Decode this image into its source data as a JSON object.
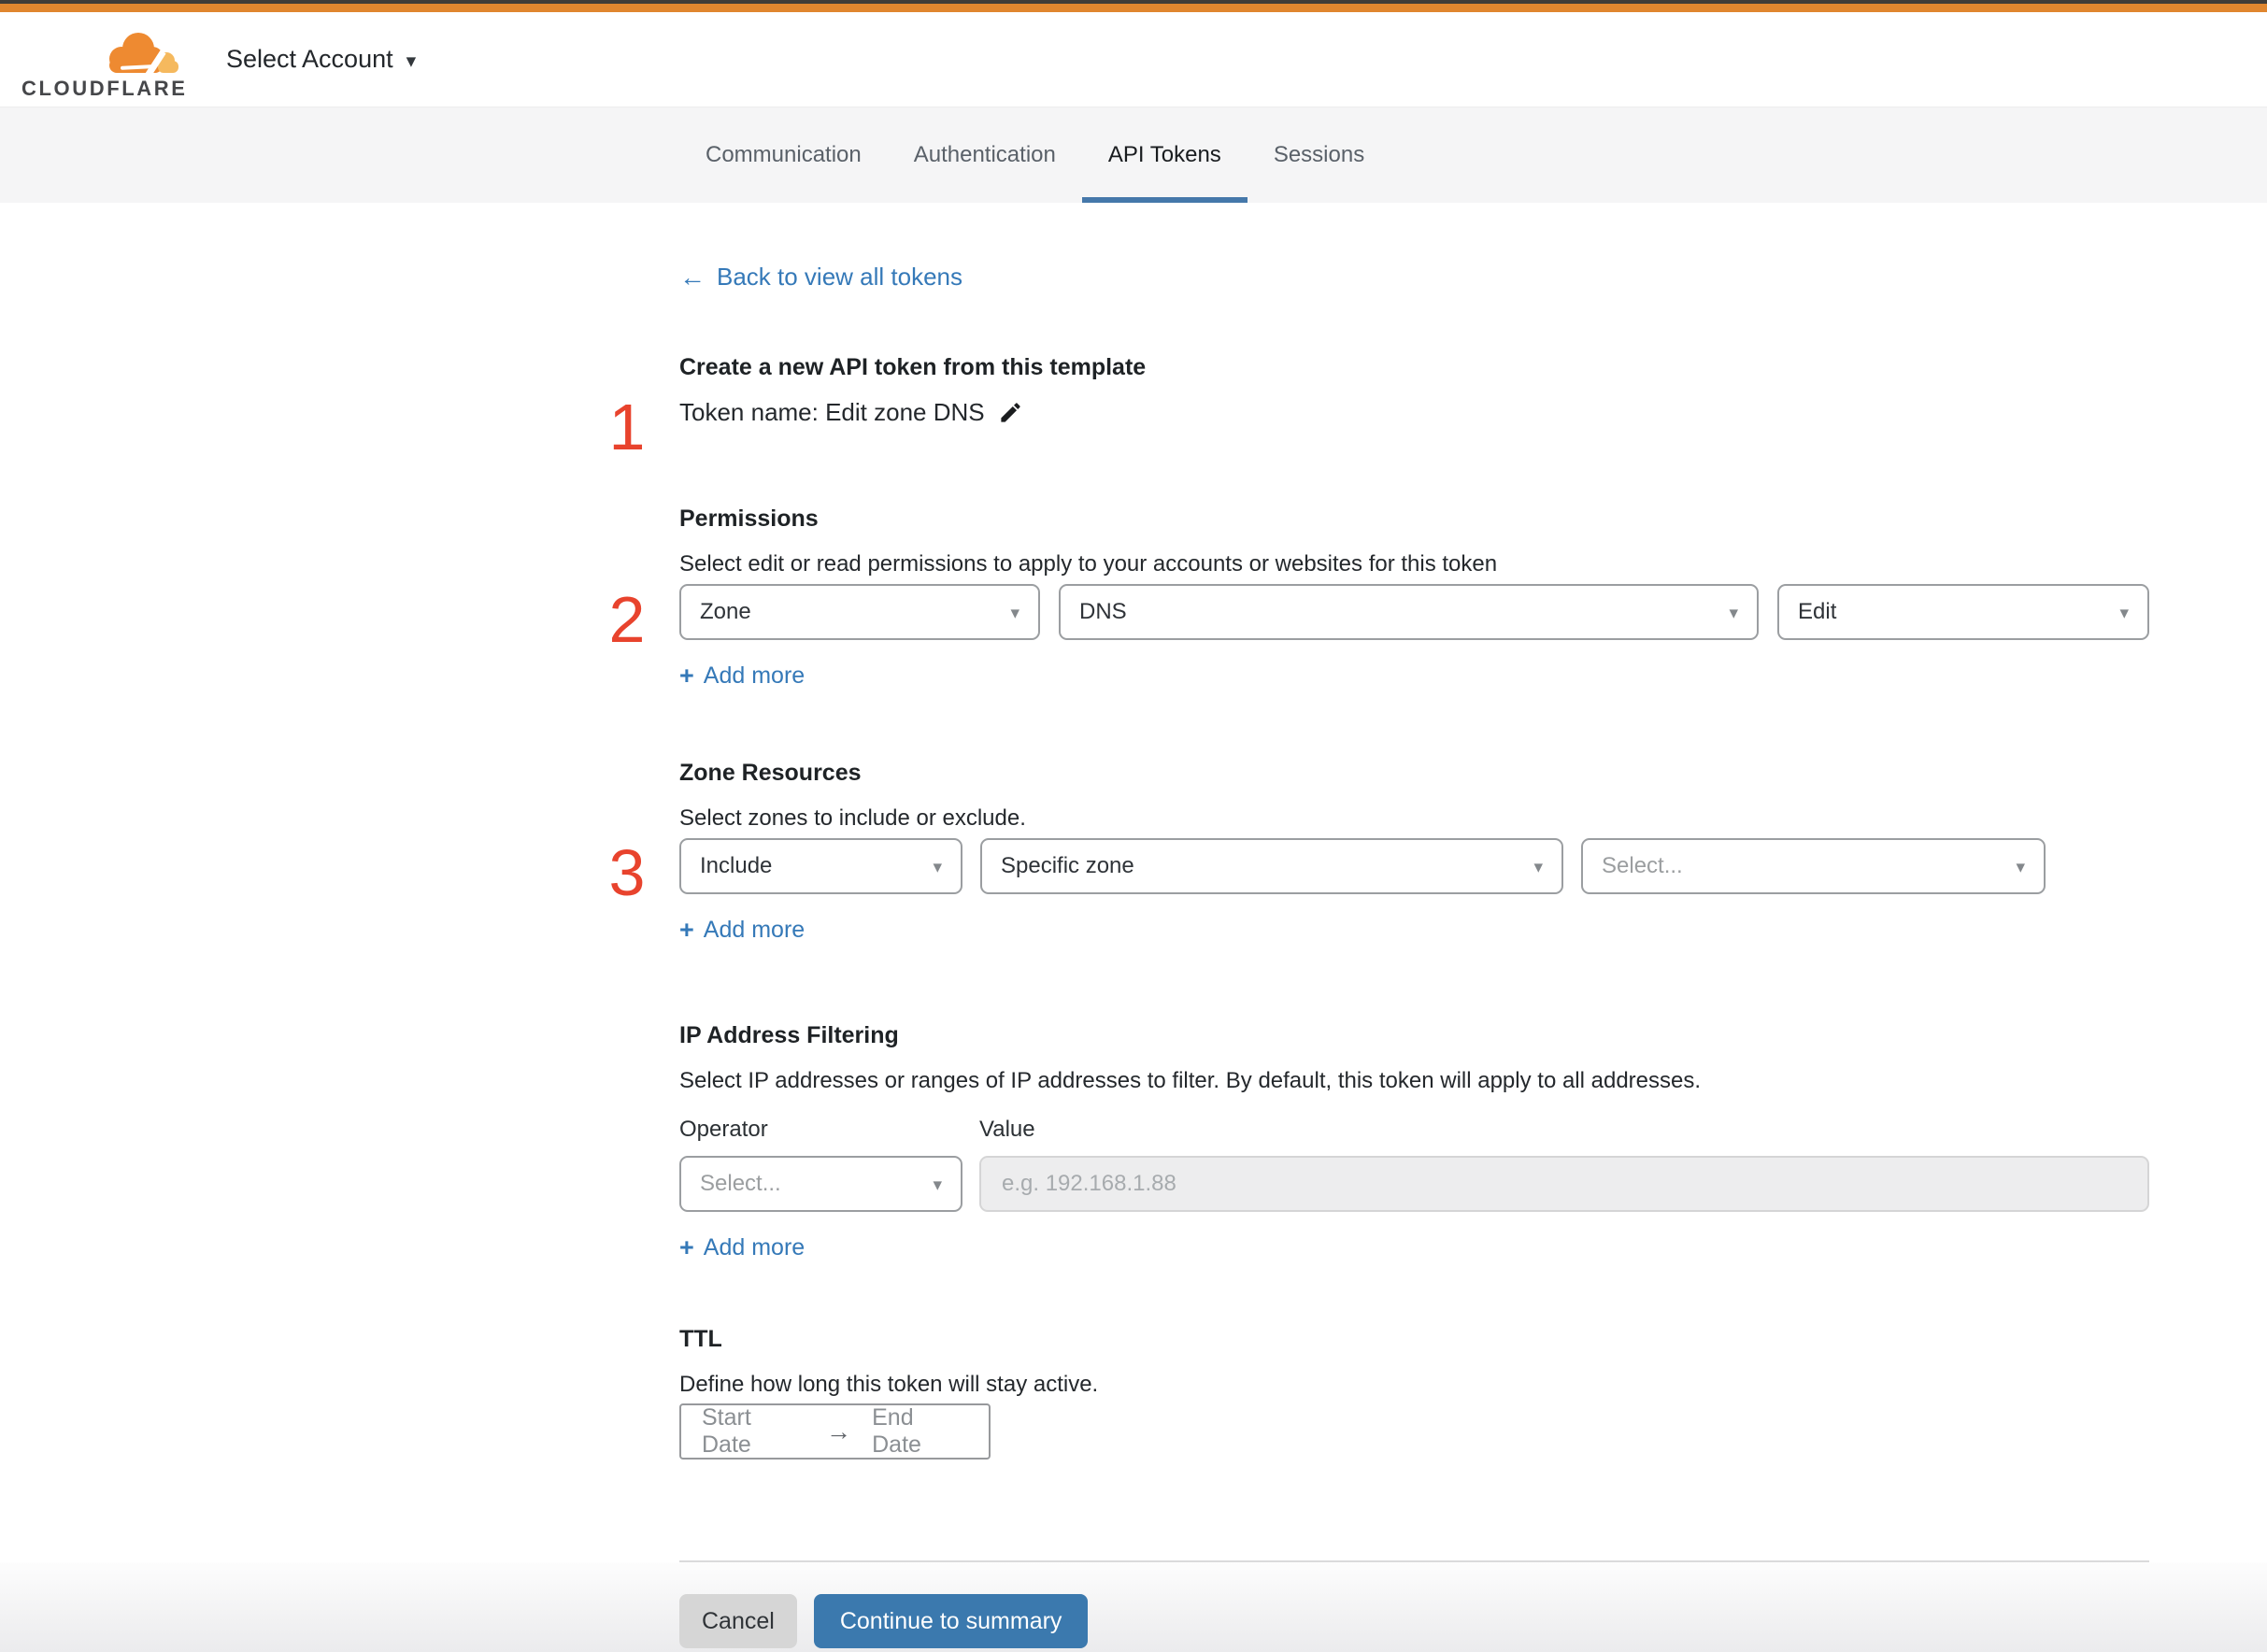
{
  "colors": {
    "top_bar_orange": "#e0862f",
    "step_number_red": "#e8432d",
    "link_blue": "#3579b8",
    "primary_button_blue": "#3b79ae",
    "tab_underline_blue": "#4578aa"
  },
  "header": {
    "brand": "CLOUDFLARE",
    "account_selector": "Select Account"
  },
  "tabs": {
    "items": [
      {
        "label": "Communication",
        "active": false
      },
      {
        "label": "Authentication",
        "active": false
      },
      {
        "label": "API Tokens",
        "active": true
      },
      {
        "label": "Sessions",
        "active": false
      }
    ]
  },
  "back_link": {
    "arrow": "←",
    "label": "Back to view all tokens"
  },
  "steps": [
    "1",
    "2",
    "3"
  ],
  "token_section": {
    "title": "Create a new API token from this template",
    "token_name": "Token name: Edit zone DNS"
  },
  "permissions": {
    "title": "Permissions",
    "description": "Select edit or read permissions to apply to your accounts or websites for this token",
    "scope_value": "Zone",
    "permission_value": "DNS",
    "access_value": "Edit",
    "add_more": "Add more"
  },
  "zone_resources": {
    "title": "Zone Resources",
    "description": "Select zones to include or exclude.",
    "operator_value": "Include",
    "type_value": "Specific zone",
    "zone_placeholder": "Select...",
    "add_more": "Add more"
  },
  "ip_filtering": {
    "title": "IP Address Filtering",
    "description": "Select IP addresses or ranges of IP addresses to filter. By default, this token will apply to all addresses.",
    "operator_label": "Operator",
    "value_label": "Value",
    "operator_placeholder": "Select...",
    "value_placeholder": "e.g. 192.168.1.88",
    "add_more": "Add more"
  },
  "ttl": {
    "title": "TTL",
    "description": "Define how long this token will stay active.",
    "start_date": "Start Date",
    "arrow": "→",
    "end_date": "End Date"
  },
  "footer": {
    "cancel": "Cancel",
    "continue": "Continue to summary"
  },
  "icons": {
    "plus": "+",
    "caret": "▾"
  }
}
